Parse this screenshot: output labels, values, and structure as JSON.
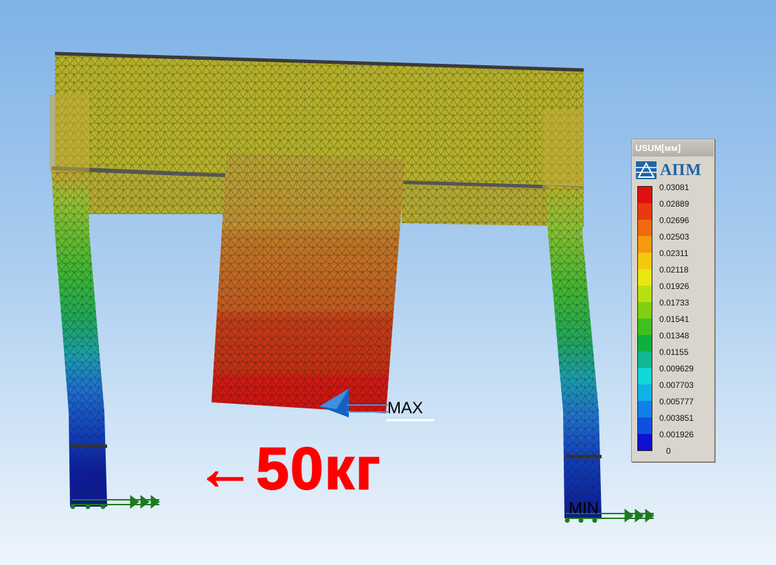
{
  "labels": {
    "max": "MAX",
    "min": "MIN",
    "load": "←50кг"
  },
  "legend": {
    "title": "USUM[мм]",
    "logo_text": "АПМ",
    "values": [
      "0.03081",
      "0.02889",
      "0.02696",
      "0.02503",
      "0.02311",
      "0.02118",
      "0.01926",
      "0.01733",
      "0.01541",
      "0.01348",
      "0.01155",
      "0.009629",
      "0.007703",
      "0.005777",
      "0.003851",
      "0.001926",
      "0"
    ],
    "colors": [
      "#e01010",
      "#e83a10",
      "#ee6a10",
      "#f59a10",
      "#f5c810",
      "#e8e810",
      "#b8e010",
      "#80d010",
      "#40c020",
      "#10b040",
      "#10b890",
      "#10d8d8",
      "#10b0e8",
      "#1080e8",
      "#1050e0",
      "#1010d0"
    ]
  },
  "colors": {
    "frame_top": "#b7b32a",
    "weight_top": "#b7a030",
    "weight_bottom": "#c11a10",
    "support_bottom": "#0c1c9c",
    "load_arrow": "#ff0000",
    "constraint": "#1e7a1e"
  },
  "icons": {
    "load_vector": "blue-cone-arrow-icon",
    "constraint": "fixed-support-arrows-icon",
    "logo": "apm-logo-icon"
  }
}
